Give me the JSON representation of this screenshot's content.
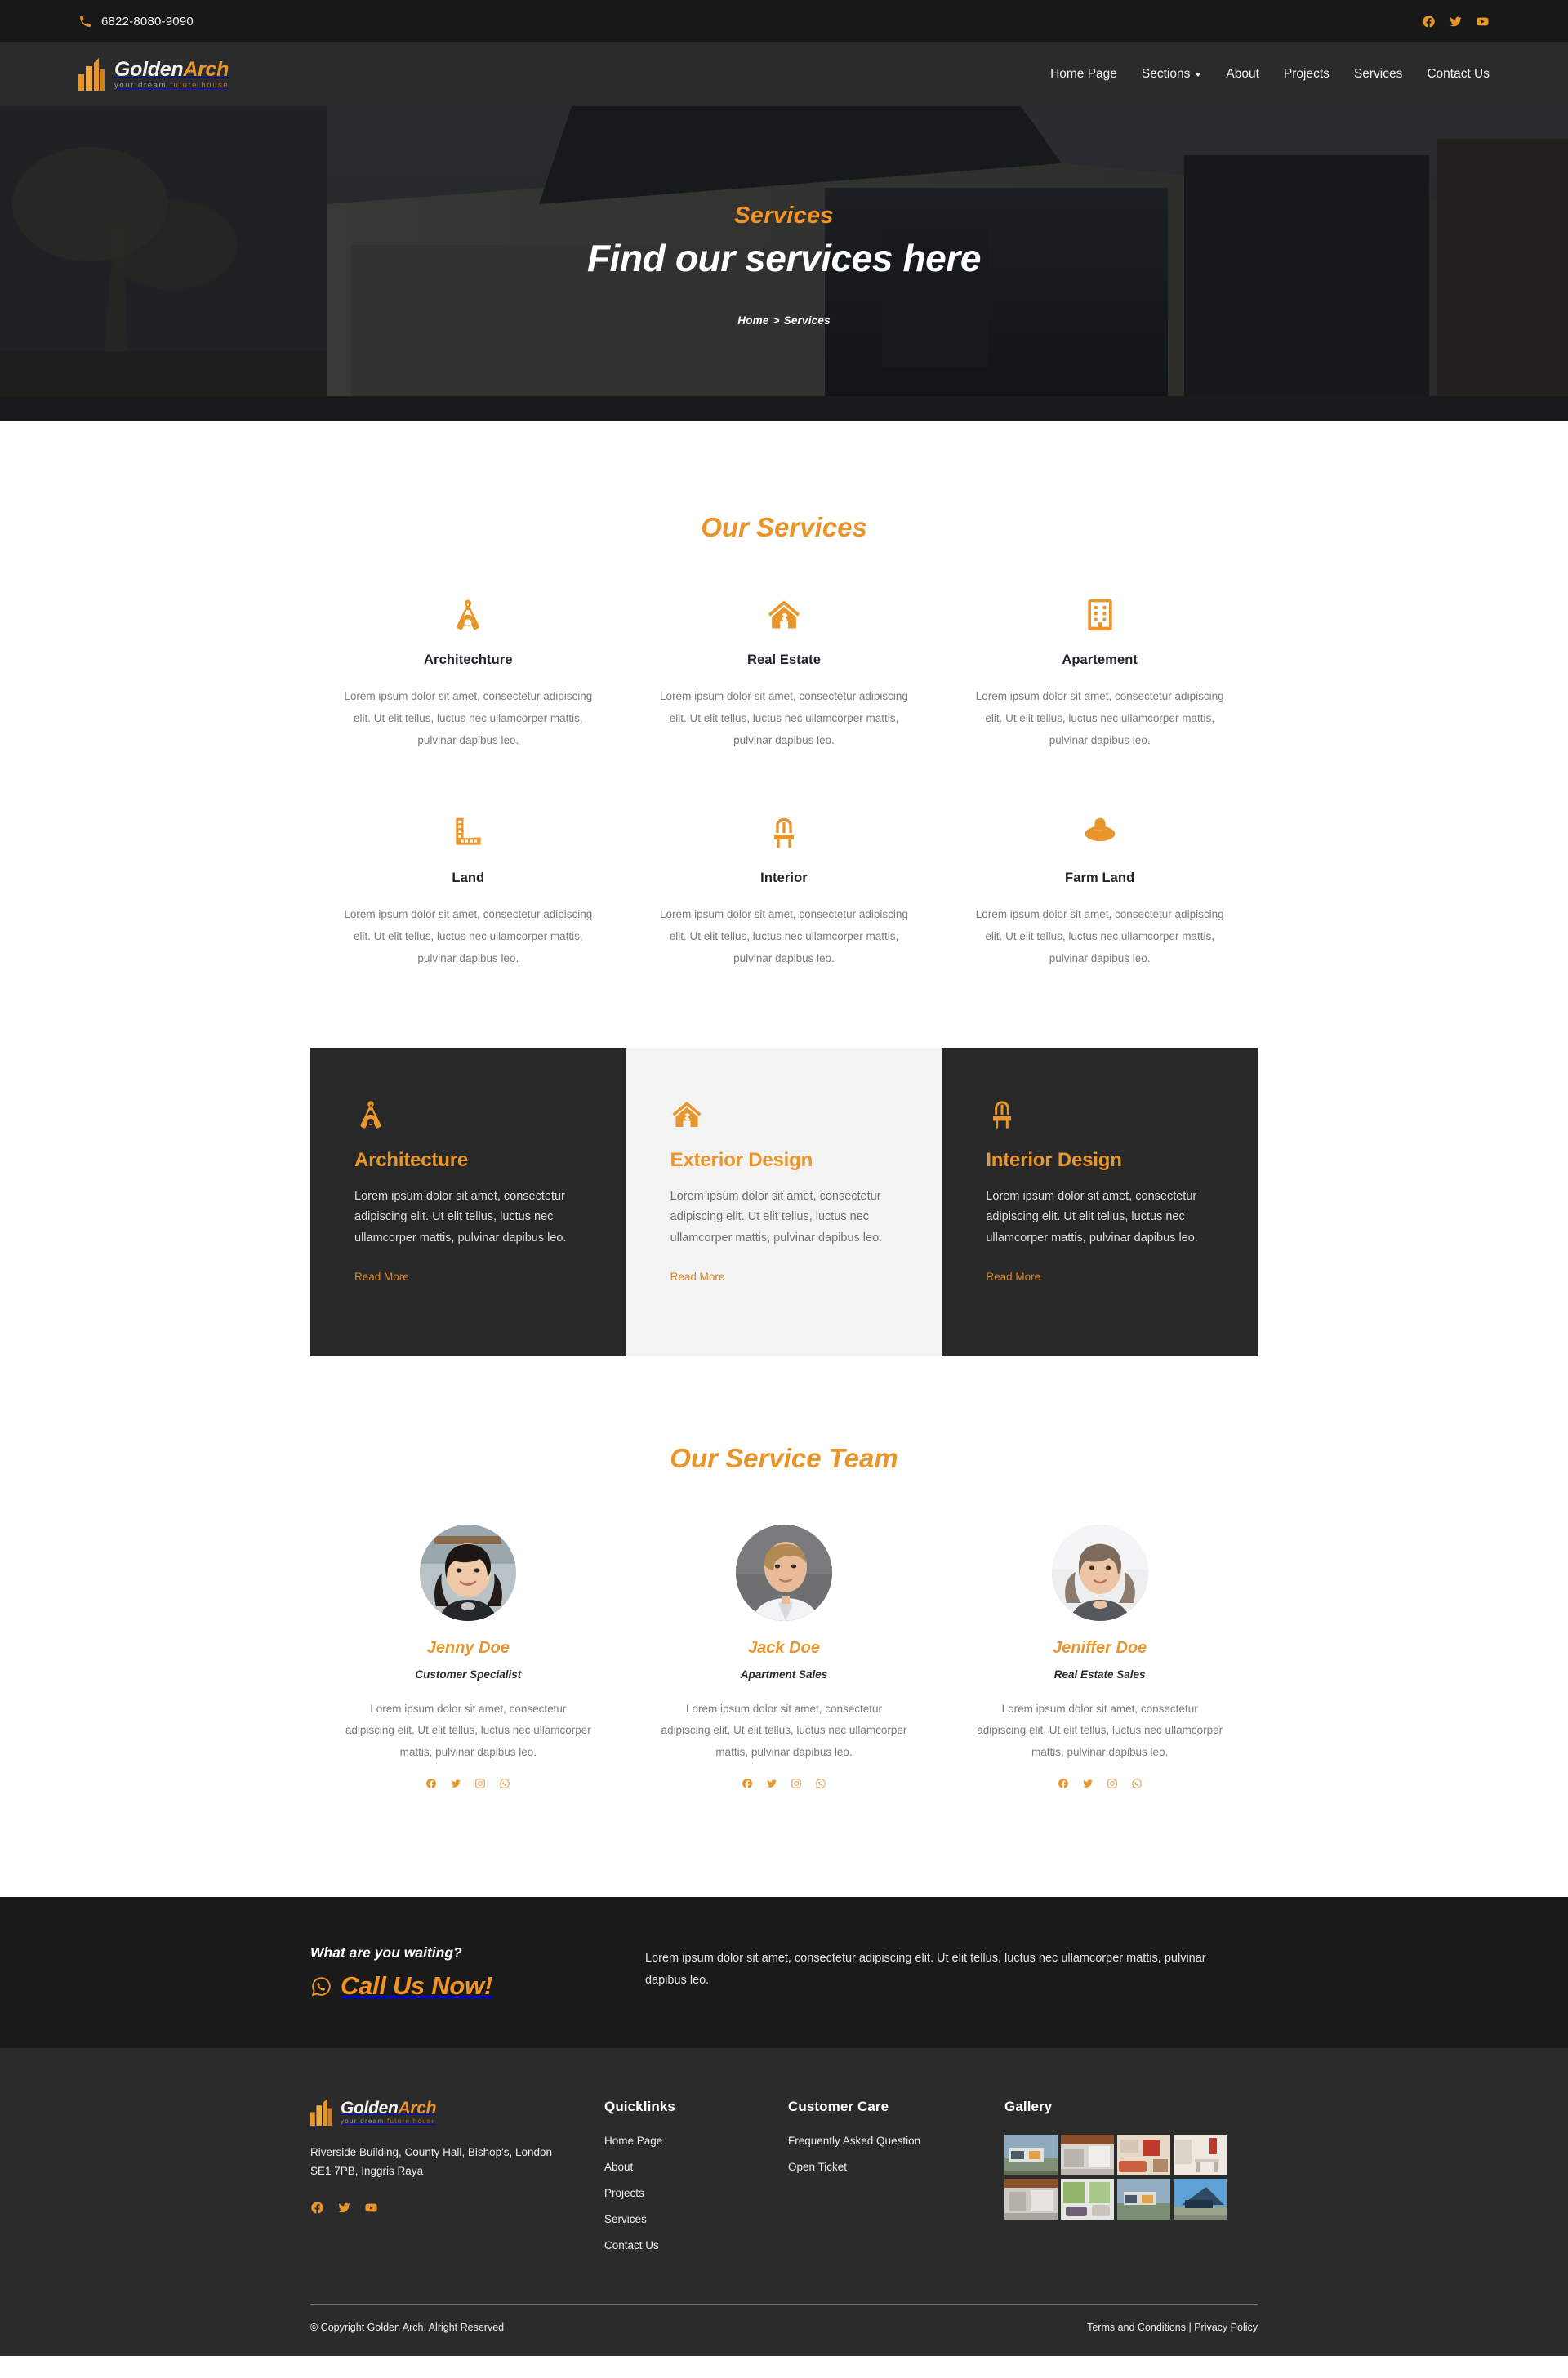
{
  "brand": {
    "name_part1": "Golden",
    "name_part2": "Arch",
    "tagline_part1": "your dream ",
    "tagline_part2": "future house"
  },
  "topbar": {
    "phone": "6822-8080-9090",
    "phone_icon": "phone-icon",
    "social": [
      {
        "name": "facebook-icon",
        "label": "Facebook"
      },
      {
        "name": "twitter-icon",
        "label": "Twitter"
      },
      {
        "name": "youtube-icon",
        "label": "YouTube"
      }
    ]
  },
  "nav": {
    "items": [
      {
        "label": "Home Page",
        "has_dropdown": false
      },
      {
        "label": "Sections",
        "has_dropdown": true
      },
      {
        "label": "About",
        "has_dropdown": false
      },
      {
        "label": "Projects",
        "has_dropdown": false
      },
      {
        "label": "Services",
        "has_dropdown": false
      },
      {
        "label": "Contact Us",
        "has_dropdown": false
      }
    ]
  },
  "hero": {
    "kicker": "Services",
    "title": "Find our services here",
    "breadcrumb_home": "Home",
    "breadcrumb_sep": ">",
    "breadcrumb_current": "Services"
  },
  "services": {
    "heading": "Our Services",
    "items": [
      {
        "icon": "compass-drafting-icon",
        "name": "Architechture",
        "desc": "Lorem ipsum dolor sit amet, consectetur adipiscing elit. Ut elit tellus, luctus nec ullamcorper mattis, pulvinar dapibus leo."
      },
      {
        "icon": "house-icon",
        "name": "Real Estate",
        "desc": "Lorem ipsum dolor sit amet, consectetur adipiscing elit. Ut elit tellus, luctus nec ullamcorper mattis, pulvinar dapibus leo."
      },
      {
        "icon": "building-icon",
        "name": "Apartement",
        "desc": "Lorem ipsum dolor sit amet, consectetur adipiscing elit. Ut elit tellus, luctus nec ullamcorper mattis, pulvinar dapibus leo."
      },
      {
        "icon": "ruler-icon",
        "name": "Land",
        "desc": "Lorem ipsum dolor sit amet, consectetur adipiscing elit. Ut elit tellus, luctus nec ullamcorper mattis, pulvinar dapibus leo."
      },
      {
        "icon": "chair-icon",
        "name": "Interior",
        "desc": "Lorem ipsum dolor sit amet, consectetur adipiscing elit. Ut elit tellus, luctus nec ullamcorper mattis, pulvinar dapibus leo."
      },
      {
        "icon": "cowboy-hat-icon",
        "name": "Farm Land",
        "desc": "Lorem ipsum dolor sit amet, consectetur adipiscing elit. Ut elit tellus, luctus nec ullamcorper mattis, pulvinar dapibus leo."
      }
    ]
  },
  "panels": [
    {
      "icon": "compass-drafting-icon",
      "title": "Architecture",
      "desc": "Lorem ipsum dolor sit amet, consectetur adipiscing elit. Ut elit tellus, luctus nec ullamcorper mattis, pulvinar dapibus leo.",
      "link": "Read More",
      "theme": "dark"
    },
    {
      "icon": "house-icon",
      "title": "Exterior Design",
      "desc": "Lorem ipsum dolor sit amet, consectetur adipiscing elit. Ut elit tellus, luctus nec ullamcorper mattis, pulvinar dapibus leo.",
      "link": "Read More",
      "theme": "light"
    },
    {
      "icon": "chair-icon",
      "title": "Interior Design",
      "desc": "Lorem ipsum dolor sit amet, consectetur adipiscing elit. Ut elit tellus, luctus nec ullamcorper mattis, pulvinar dapibus leo.",
      "link": "Read More",
      "theme": "dark"
    }
  ],
  "team": {
    "heading": "Our Service Team",
    "members": [
      {
        "avatar": "avatar-jenny",
        "name": "Jenny Doe",
        "role": "Customer Specialist",
        "desc": "Lorem ipsum dolor sit amet, consectetur adipiscing elit. Ut elit tellus, luctus nec ullamcorper mattis, pulvinar dapibus leo."
      },
      {
        "avatar": "avatar-jack",
        "name": "Jack Doe",
        "role": "Apartment Sales",
        "desc": "Lorem ipsum dolor sit amet, consectetur adipiscing elit. Ut elit tellus, luctus nec ullamcorper mattis, pulvinar dapibus leo."
      },
      {
        "avatar": "avatar-jeniffer",
        "name": "Jeniffer Doe",
        "role": "Real Estate Sales",
        "desc": "Lorem ipsum dolor sit amet, consectetur adipiscing elit. Ut elit tellus, luctus nec ullamcorper mattis, pulvinar dapibus leo."
      }
    ],
    "social": [
      {
        "name": "facebook-icon"
      },
      {
        "name": "twitter-icon"
      },
      {
        "name": "instagram-icon"
      },
      {
        "name": "whatsapp-icon"
      }
    ]
  },
  "cta": {
    "kicker": "What are you waiting?",
    "call_label": "Call Us Now!",
    "call_icon": "whatsapp-icon",
    "desc": "Lorem ipsum dolor sit amet, consectetur adipiscing elit. Ut elit tellus, luctus nec ullamcorper mattis, pulvinar dapibus leo."
  },
  "footer": {
    "address": "Riverside Building, County Hall, Bishop's, London SE1 7PB, Inggris Raya",
    "social": [
      {
        "name": "facebook-icon"
      },
      {
        "name": "twitter-icon"
      },
      {
        "name": "youtube-icon"
      }
    ],
    "quicklinks": {
      "heading": "Quicklinks",
      "items": [
        "Home Page",
        "About",
        "Projects",
        "Services",
        "Contact Us"
      ]
    },
    "customer_care": {
      "heading": "Customer Care",
      "items": [
        "Frequently Asked Question",
        "Open Ticket"
      ]
    },
    "gallery": {
      "heading": "Gallery",
      "thumbs": [
        "gallery-exterior-1",
        "gallery-kitchen-1",
        "gallery-living-1",
        "gallery-dining-1",
        "gallery-kitchen-2",
        "gallery-living-2",
        "gallery-exterior-2",
        "gallery-exterior-3"
      ]
    },
    "copyright": "© Copyright Golden Arch. Alright Reserved",
    "terms_label": "Terms and Conditions",
    "legal_sep": " | ",
    "privacy_label": "Privacy Policy"
  },
  "colors": {
    "accent": "#e8952b",
    "accent_bright": "#ef9425",
    "dark": "#2b2b2b",
    "darker": "#1a1a1a",
    "panel_dark": "#282828",
    "panel_light": "#f3f3f3"
  }
}
